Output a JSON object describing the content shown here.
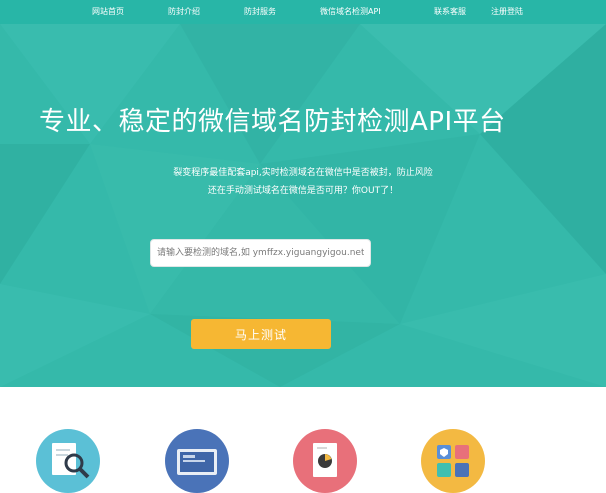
{
  "nav": {
    "items": [
      {
        "label": "网站首页"
      },
      {
        "label": "防封介绍"
      },
      {
        "label": "防封服务"
      },
      {
        "label": "微信域名检测API"
      },
      {
        "label": "联系客服"
      },
      {
        "label": "注册登陆"
      }
    ]
  },
  "hero": {
    "title": "专业、稳定的微信域名防封检测API平台",
    "desc_line1": "裂变程序最佳配套api,实时检测域名在微信中是否被封，防止风险",
    "desc_line2": "还在手动测试域名在微信是否可用？你OUT了！",
    "search_placeholder": "请输入要检测的域名,如 ymffzx.yiguangyigou.net",
    "button_label": "马上测试"
  },
  "features": {
    "icons": [
      {
        "name": "document-magnifier-icon",
        "bg": "#5bc0d6"
      },
      {
        "name": "monitor-icon",
        "bg": "#4a73b8"
      },
      {
        "name": "report-chart-icon",
        "bg": "#e8707a"
      },
      {
        "name": "security-apps-icon",
        "bg": "#f3b942"
      }
    ]
  },
  "colors": {
    "primary": "#35b9aa",
    "accent": "#f6b733"
  }
}
